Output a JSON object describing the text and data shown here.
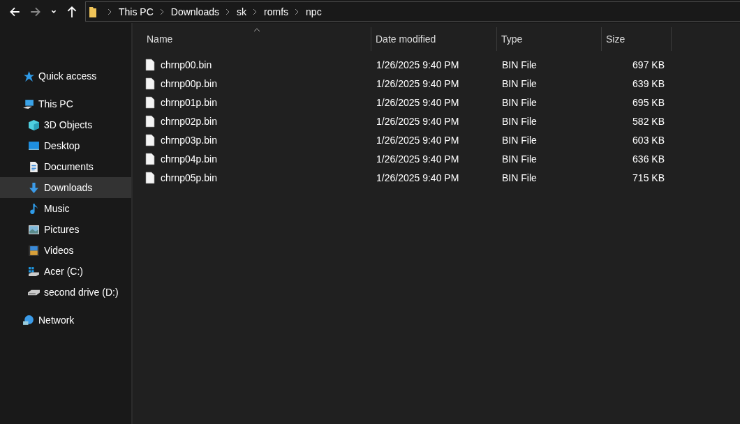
{
  "nav": {
    "back": {
      "disabled": false
    },
    "forward": {
      "disabled": true
    },
    "recent": {
      "disabled": false
    },
    "up": {
      "disabled": false
    }
  },
  "breadcrumb": [
    "This PC",
    "Downloads",
    "sk",
    "romfs",
    "npc"
  ],
  "sidebar": [
    {
      "label": "Quick access",
      "kind": "star",
      "selected": false
    },
    {
      "label": "This PC",
      "kind": "pc",
      "selected": false,
      "children": [
        {
          "label": "3D Objects",
          "kind": "cube",
          "selected": false
        },
        {
          "label": "Desktop",
          "kind": "desktop",
          "selected": false
        },
        {
          "label": "Documents",
          "kind": "documents",
          "selected": false
        },
        {
          "label": "Downloads",
          "kind": "download",
          "selected": true
        },
        {
          "label": "Music",
          "kind": "music",
          "selected": false
        },
        {
          "label": "Pictures",
          "kind": "pictures",
          "selected": false
        },
        {
          "label": "Videos",
          "kind": "videos",
          "selected": false
        },
        {
          "label": "Acer (C:)",
          "kind": "system-drive",
          "selected": false
        },
        {
          "label": "second drive (D:)",
          "kind": "drive",
          "selected": false
        }
      ]
    },
    {
      "label": "Network",
      "kind": "network",
      "selected": false
    }
  ],
  "table": {
    "columns": [
      {
        "label": "Name",
        "sorted": true
      },
      {
        "label": "Date modified",
        "sorted": false
      },
      {
        "label": "Type",
        "sorted": false
      },
      {
        "label": "Size",
        "sorted": false
      }
    ],
    "rows": [
      {
        "name": "chrnp00.bin",
        "date": "1/26/2025 9:40 PM",
        "type": "BIN File",
        "size": "697 KB"
      },
      {
        "name": "chrnp00p.bin",
        "date": "1/26/2025 9:40 PM",
        "type": "BIN File",
        "size": "639 KB"
      },
      {
        "name": "chrnp01p.bin",
        "date": "1/26/2025 9:40 PM",
        "type": "BIN File",
        "size": "695 KB"
      },
      {
        "name": "chrnp02p.bin",
        "date": "1/26/2025 9:40 PM",
        "type": "BIN File",
        "size": "582 KB"
      },
      {
        "name": "chrnp03p.bin",
        "date": "1/26/2025 9:40 PM",
        "type": "BIN File",
        "size": "603 KB"
      },
      {
        "name": "chrnp04p.bin",
        "date": "1/26/2025 9:40 PM",
        "type": "BIN File",
        "size": "636 KB"
      },
      {
        "name": "chrnp05p.bin",
        "date": "1/26/2025 9:40 PM",
        "type": "BIN File",
        "size": "715 KB"
      }
    ]
  }
}
